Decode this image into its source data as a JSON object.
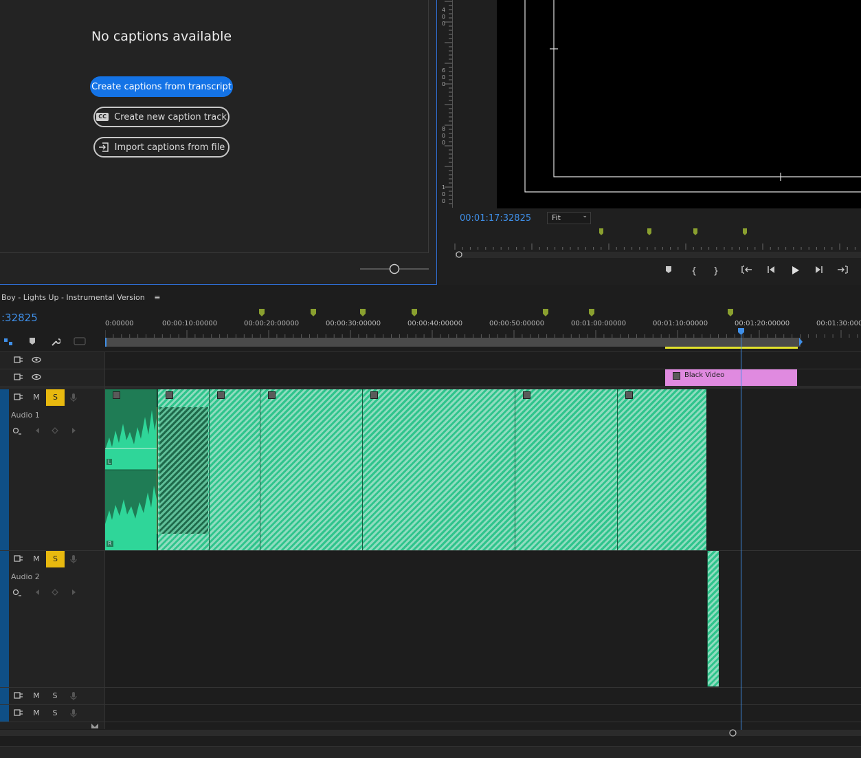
{
  "captions": {
    "heading": "No captions available",
    "create_from_transcript": "Create captions from transcript",
    "create_new_track": "Create new caption track",
    "import_from_file": "Import captions from file",
    "cc_icon_text": "CC"
  },
  "program": {
    "timecode": "00:01:17:32825",
    "fit_value": "Fit",
    "ruler_digits": [
      "4",
      "0",
      "0",
      "6",
      "0",
      "0",
      "8",
      "0",
      "0",
      "1",
      "0",
      "0"
    ]
  },
  "timeline": {
    "sequence_title": "Boy - Lights Up - Instrumental Version",
    "menu_icon": "≡",
    "timecode": ":32825",
    "ticks": [
      "0:00000",
      "00:00:10:00000",
      "00:00:20:00000",
      "00:00:30:00000",
      "00:00:40:00000",
      "00:00:50:00000",
      "00:01:00:00000",
      "00:01:10:00000",
      "00:01:20:00000",
      "00:01:30:000"
    ],
    "tracks": {
      "audio1": {
        "name": "Audio 1",
        "m": "M",
        "s": "S",
        "l_label": "L",
        "r_label": "R"
      },
      "audio2": {
        "name": "Audio 2",
        "m": "M",
        "s": "S"
      },
      "audio3": {
        "m": "M",
        "s": "S"
      },
      "audio4": {
        "m": "M",
        "s": "S"
      }
    },
    "black_video_label": "Black Video",
    "playhead_time": "00:01:17:32825"
  },
  "colors": {
    "accent": "#1473e6",
    "timecode": "#3f8fe8",
    "audio_clip": "#2fc48c",
    "video_clip": "#e08ae0",
    "solo": "#e8b90f",
    "marker": "#8aa02f"
  }
}
